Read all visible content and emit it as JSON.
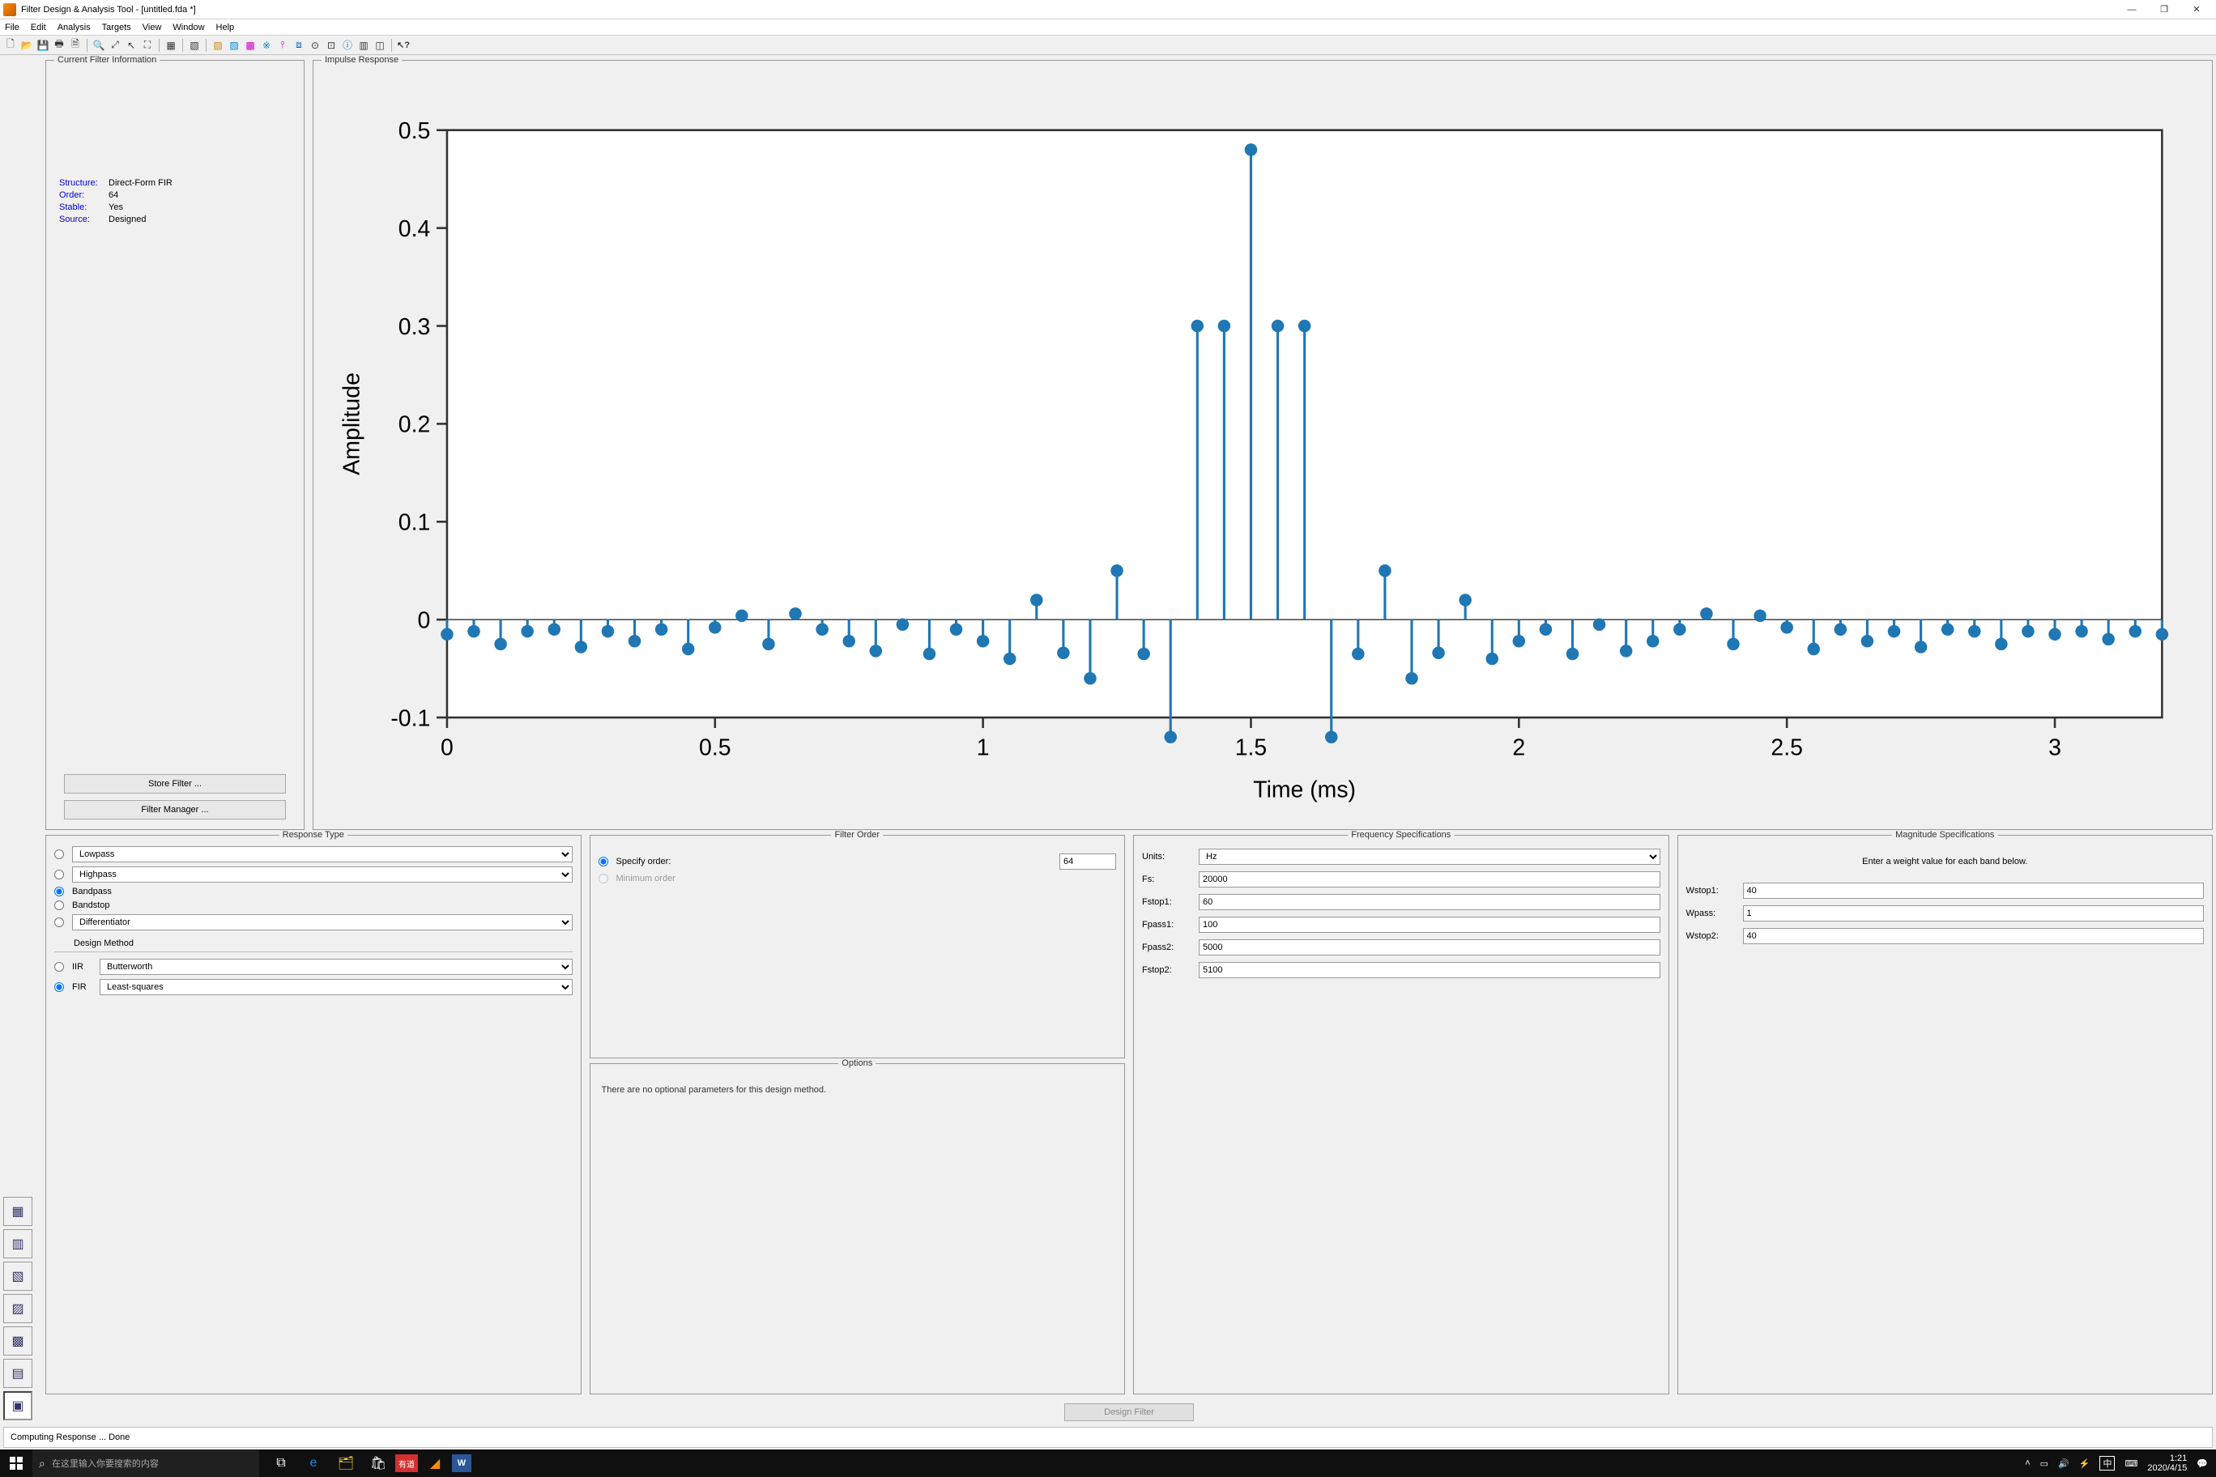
{
  "title": "Filter Design & Analysis Tool -  [untitled.fda *]",
  "menus": [
    "File",
    "Edit",
    "Analysis",
    "Targets",
    "View",
    "Window",
    "Help"
  ],
  "window_buttons": {
    "min": "—",
    "max": "❐",
    "close": "✕"
  },
  "panels": {
    "filter_info": {
      "legend": "Current Filter Information",
      "rows": [
        {
          "k": "Structure:",
          "v": "Direct-Form FIR"
        },
        {
          "k": "Order:",
          "v": "64"
        },
        {
          "k": "Stable:",
          "v": "Yes"
        },
        {
          "k": "Source:",
          "v": "Designed"
        }
      ],
      "store_btn": "Store Filter ...",
      "manager_btn": "Filter Manager ..."
    },
    "impulse": {
      "legend": "Impulse Response",
      "xlabel": "Time (ms)",
      "ylabel": "Amplitude"
    },
    "response_type": {
      "legend": "Response Type",
      "options": [
        "Lowpass",
        "Highpass",
        "Bandpass",
        "Bandstop",
        "Differentiator"
      ],
      "selected": "Bandpass",
      "design_method_label": "Design Method",
      "iir_label": "IIR",
      "iir_sel": "Butterworth",
      "fir_label": "FIR",
      "fir_sel": "Least-squares"
    },
    "filter_order": {
      "legend": "Filter Order",
      "specify_label": "Specify order:",
      "specify_value": "64",
      "min_label": "Minimum order"
    },
    "options": {
      "legend": "Options",
      "text": "There are no optional parameters for this design method."
    },
    "freq": {
      "legend": "Frequency Specifications",
      "units_label": "Units:",
      "units_value": "Hz",
      "fields": [
        {
          "label": "Fs:",
          "value": "20000"
        },
        {
          "label": "Fstop1:",
          "value": "60"
        },
        {
          "label": "Fpass1:",
          "value": "100"
        },
        {
          "label": "Fpass2:",
          "value": "5000"
        },
        {
          "label": "Fstop2:",
          "value": "5100"
        }
      ]
    },
    "mag": {
      "legend": "Magnitude Specifications",
      "hint": "Enter a weight value for each band below.",
      "fields": [
        {
          "label": "Wstop1:",
          "value": "40"
        },
        {
          "label": "Wpass:",
          "value": "1"
        },
        {
          "label": "Wstop2:",
          "value": "40"
        }
      ]
    }
  },
  "design_btn": "Design Filter",
  "status": "Computing Response ... Done",
  "taskbar": {
    "search_placeholder": "在这里输入你要搜索的内容",
    "clock_time": "1:21",
    "clock_date": "2020/4/15",
    "ime": "中"
  },
  "chart_data": {
    "type": "stem",
    "title": "Impulse Response",
    "xlabel": "Time (ms)",
    "ylabel": "Amplitude",
    "xlim": [
      0,
      3.2
    ],
    "ylim": [
      -0.1,
      0.5
    ],
    "xticks": [
      0,
      0.5,
      1,
      1.5,
      2,
      2.5,
      3
    ],
    "yticks": [
      -0.1,
      0,
      0.1,
      0.2,
      0.3,
      0.4,
      0.5
    ],
    "x": [
      0.0,
      0.05,
      0.1,
      0.15,
      0.2,
      0.25,
      0.3,
      0.35,
      0.4,
      0.45,
      0.5,
      0.55,
      0.6,
      0.65,
      0.7,
      0.75,
      0.8,
      0.85,
      0.9,
      0.95,
      1.0,
      1.05,
      1.1,
      1.15,
      1.2,
      1.25,
      1.3,
      1.35,
      1.4,
      1.45,
      1.5,
      1.55,
      1.6,
      1.65,
      1.7,
      1.75,
      1.8,
      1.85,
      1.9,
      1.95,
      2.0,
      2.05,
      2.1,
      2.15,
      2.2,
      2.25,
      2.3,
      2.35,
      2.4,
      2.45,
      2.5,
      2.55,
      2.6,
      2.65,
      2.7,
      2.75,
      2.8,
      2.85,
      2.9,
      2.95,
      3.0,
      3.05,
      3.1,
      3.15,
      3.2
    ],
    "y": [
      -0.015,
      -0.012,
      -0.025,
      -0.012,
      -0.01,
      -0.028,
      -0.012,
      -0.022,
      -0.01,
      -0.03,
      -0.008,
      0.004,
      -0.025,
      0.006,
      -0.01,
      -0.022,
      -0.032,
      -0.005,
      -0.035,
      -0.01,
      -0.022,
      -0.04,
      0.02,
      -0.034,
      -0.06,
      0.05,
      -0.035,
      -0.12,
      0.3,
      0.3,
      0.48,
      0.3,
      0.3,
      -0.12,
      -0.035,
      0.05,
      -0.06,
      -0.034,
      0.02,
      -0.04,
      -0.022,
      -0.01,
      -0.035,
      -0.005,
      -0.032,
      -0.022,
      -0.01,
      0.006,
      -0.025,
      0.004,
      -0.008,
      -0.03,
      -0.01,
      -0.022,
      -0.012,
      -0.028,
      -0.01,
      -0.012,
      -0.025,
      -0.012,
      -0.015,
      -0.012,
      -0.02,
      -0.012,
      -0.015
    ]
  }
}
